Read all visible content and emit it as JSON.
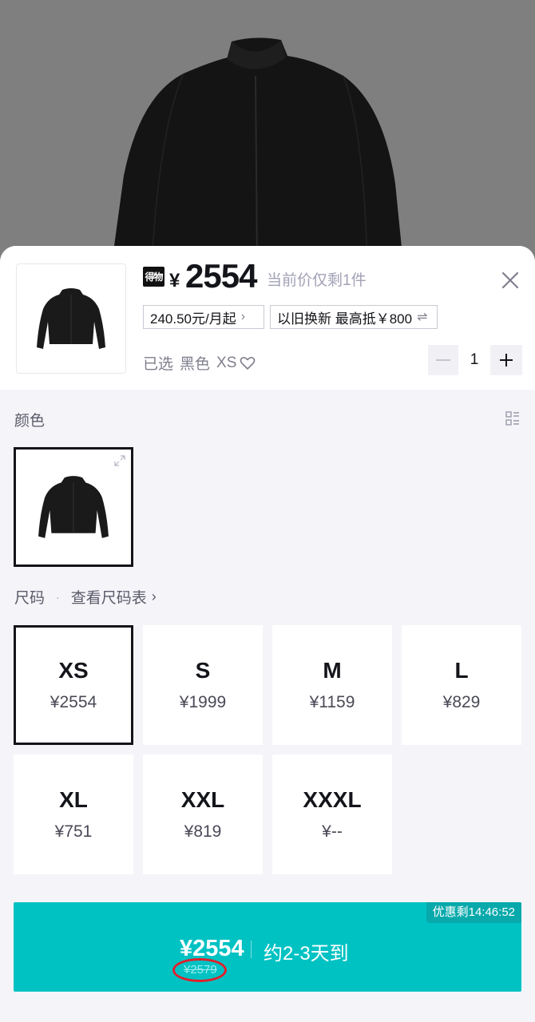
{
  "product": {
    "brand_badge": "得物",
    "price_symbol": "¥",
    "price": "2554",
    "price_note": "当前价仅剩1件",
    "installment": "240.50元/月起",
    "installment_chevron": "chevron-right-icon",
    "trade_in": "以旧换新 最高抵￥800",
    "trade_in_icon": "swap-icon",
    "selected_label": "已选",
    "selected_color": "黑色",
    "selected_size": "XS"
  },
  "quantity": {
    "value": "1"
  },
  "color_section": {
    "label": "颜色",
    "options": [
      {
        "name": "黑色",
        "selected": true
      }
    ]
  },
  "size_section": {
    "label": "尺码",
    "separator": "·",
    "size_chart_link": "查看尺码表",
    "sizes": [
      {
        "name": "XS",
        "price": "¥2554",
        "selected": true
      },
      {
        "name": "S",
        "price": "¥1999",
        "selected": false
      },
      {
        "name": "M",
        "price": "¥1159",
        "selected": false
      },
      {
        "name": "L",
        "price": "¥829",
        "selected": false
      },
      {
        "name": "XL",
        "price": "¥751",
        "selected": false
      },
      {
        "name": "XXL",
        "price": "¥819",
        "selected": false
      },
      {
        "name": "XXXL",
        "price": "¥--",
        "selected": false
      }
    ]
  },
  "buy_button": {
    "timer": "优惠剩14:46:52",
    "price": "¥2554",
    "original_price": "¥2579",
    "delivery": "约2-3天到",
    "color": "#01c2c3"
  }
}
